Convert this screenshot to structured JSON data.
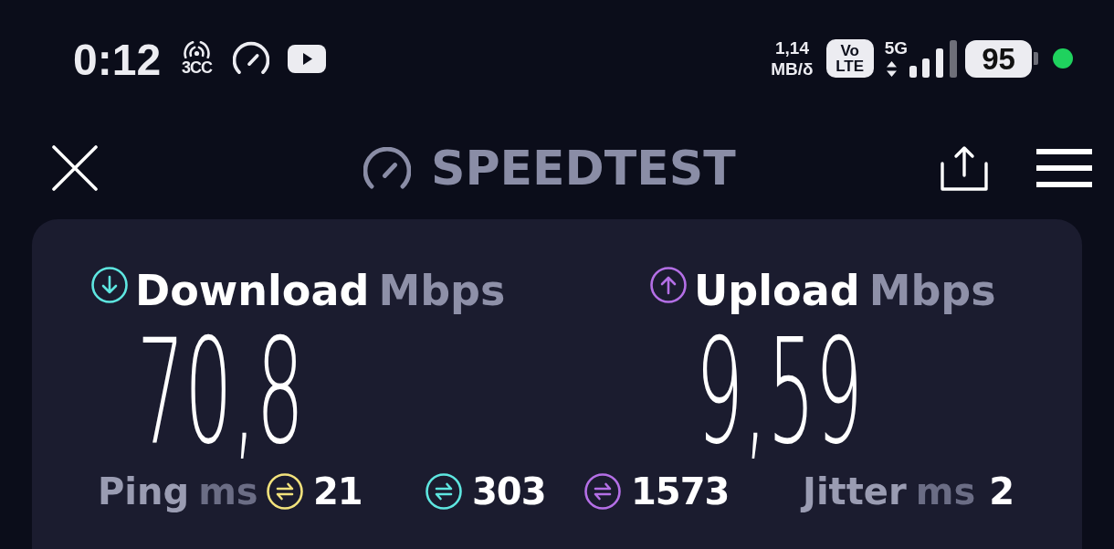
{
  "status_bar": {
    "time": "0:12",
    "hotspot_label": "3CC",
    "data_speed": "1,14",
    "data_speed_unit": "MB/δ",
    "volte": "Vo\nLTE",
    "network": "5G",
    "battery": "95"
  },
  "header": {
    "title": "SPEEDTEST"
  },
  "results": [
    {
      "kind": "download",
      "label": "Download",
      "unit": "Mbps",
      "value": "70,8",
      "color": "#5ee6e0"
    },
    {
      "kind": "upload",
      "label": "Upload",
      "unit": "Mbps",
      "value": "9,59",
      "color": "#b46fe6"
    }
  ],
  "ping": {
    "label": "Ping",
    "unit": "ms",
    "readings": [
      {
        "value": "21",
        "color": "#f2e27c"
      },
      {
        "value": "303",
        "color": "#5ee6e0"
      },
      {
        "value": "1573",
        "color": "#b46fe6"
      }
    ]
  },
  "jitter": {
    "label": "Jitter",
    "unit": "ms",
    "value": "2"
  }
}
